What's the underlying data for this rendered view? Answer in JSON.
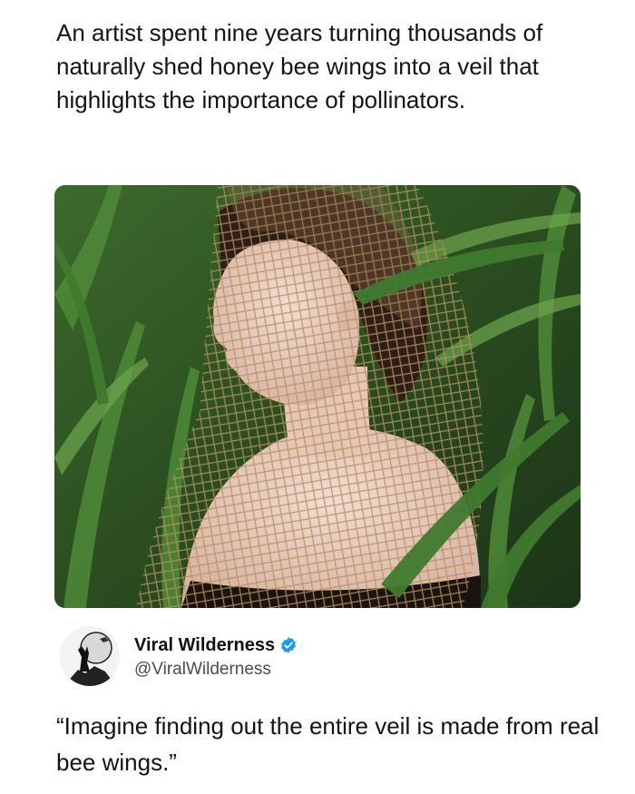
{
  "post": {
    "headline": "An artist spent nine years turning thousands of naturally shed honey bee wings into a veil that highlights the importance of pollinators."
  },
  "tweet": {
    "author_name": "Viral Wilderness",
    "author_handle": "@ViralWilderness",
    "verified": true,
    "text": "“Imagine finding out the entire veil is made from real bee wings.”"
  },
  "icons": {
    "verified": "verified-badge-icon",
    "avatar": "wolf-howling-moon-avatar"
  },
  "colors": {
    "verified_blue": "#1d9bf0",
    "text": "#141414",
    "handle": "#4b4b4b"
  }
}
